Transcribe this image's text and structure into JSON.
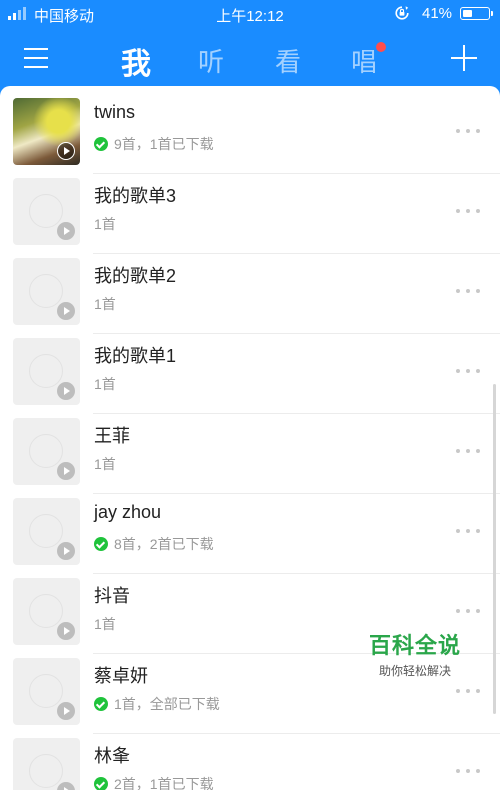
{
  "status_bar": {
    "signal_bars": 4,
    "signal_active": 2,
    "carrier": "中国移动",
    "time": "上午12:12",
    "battery_percent_text": "41%",
    "battery_level": 0.41
  },
  "nav": {
    "menu_icon": "hamburger-menu-icon",
    "tabs": [
      {
        "label": "我",
        "active": true,
        "badge": false
      },
      {
        "label": "听",
        "active": false,
        "badge": false
      },
      {
        "label": "看",
        "active": false,
        "badge": false
      },
      {
        "label": "唱",
        "active": false,
        "badge": true
      }
    ],
    "add_icon": "plus-icon"
  },
  "playlists": [
    {
      "title": "twins",
      "subtitle": "9首，1首已下载",
      "downloaded": true,
      "has_photo": true
    },
    {
      "title": "我的歌单3",
      "subtitle": "1首",
      "downloaded": false,
      "has_photo": false
    },
    {
      "title": "我的歌单2",
      "subtitle": "1首",
      "downloaded": false,
      "has_photo": false
    },
    {
      "title": "我的歌单1",
      "subtitle": "1首",
      "downloaded": false,
      "has_photo": false
    },
    {
      "title": "王菲",
      "subtitle": "1首",
      "downloaded": false,
      "has_photo": false
    },
    {
      "title": "jay zhou",
      "subtitle": "8首，2首已下载",
      "downloaded": true,
      "has_photo": false
    },
    {
      "title": "抖音",
      "subtitle": "1首",
      "downloaded": false,
      "has_photo": false
    },
    {
      "title": "蔡卓妍",
      "subtitle": "1首，全部已下载",
      "downloaded": true,
      "has_photo": false
    },
    {
      "title": "林夆",
      "subtitle": "2首，1首已下载",
      "downloaded": true,
      "has_photo": false
    }
  ],
  "watermark": {
    "main": "百科全说",
    "sub": "助你轻松解决",
    "color": "#2aa64a"
  },
  "colors": {
    "header": "#1a8cff",
    "check": "#1fc33b",
    "badge": "#ff4d4d"
  }
}
